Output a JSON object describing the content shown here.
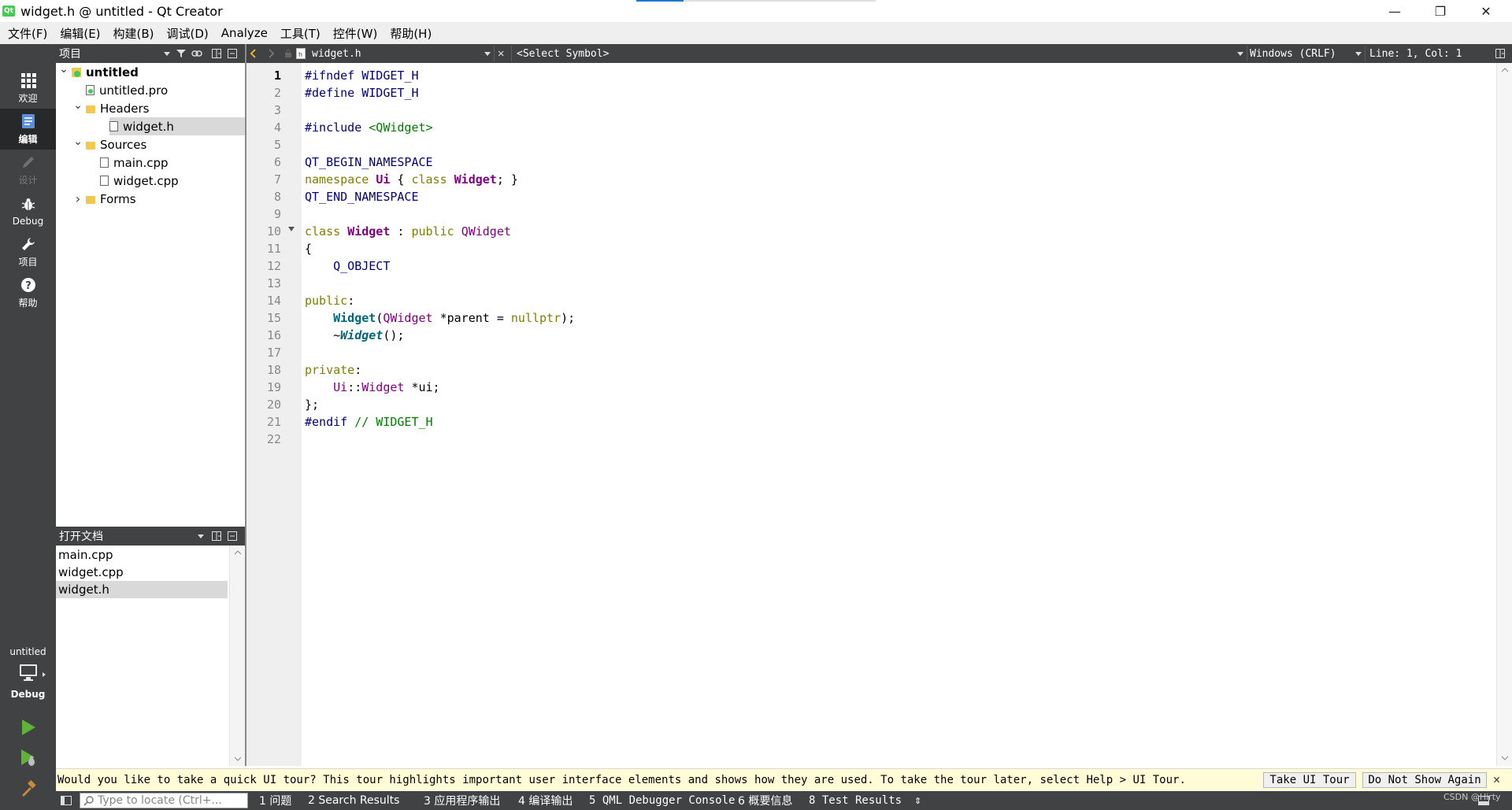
{
  "window": {
    "title": "widget.h @ untitled - Qt Creator",
    "app_icon_text": "Qt",
    "controls": {
      "minimize": "—",
      "maximize": "❐",
      "close": "✕"
    }
  },
  "menu": [
    "文件(F)",
    "编辑(E)",
    "构建(B)",
    "调试(D)",
    "Analyze",
    "工具(T)",
    "控件(W)",
    "帮助(H)"
  ],
  "modes": [
    {
      "id": "welcome",
      "label": "欢迎",
      "icon": "grid-icon",
      "state": "normal"
    },
    {
      "id": "edit",
      "label": "编辑",
      "icon": "edit-document-icon",
      "state": "active"
    },
    {
      "id": "design",
      "label": "设计",
      "icon": "pencil-icon",
      "state": "disabled"
    },
    {
      "id": "debug",
      "label": "Debug",
      "icon": "bug-icon",
      "state": "normal"
    },
    {
      "id": "projects",
      "label": "项目",
      "icon": "wrench-icon",
      "state": "normal"
    },
    {
      "id": "help",
      "label": "帮助",
      "icon": "help-icon",
      "state": "normal"
    }
  ],
  "kit": {
    "project": "untitled",
    "mode": "Debug"
  },
  "projects_pane": {
    "title": "项目",
    "tree": [
      {
        "label": "untitled",
        "depth": 0,
        "arrow": "down",
        "icon": "project-icon",
        "bold": true
      },
      {
        "label": "untitled.pro",
        "depth": 1,
        "arrow": "",
        "icon": "pro-file-icon"
      },
      {
        "label": "Headers",
        "depth": 1,
        "arrow": "down",
        "icon": "folder-icon"
      },
      {
        "label": "widget.h",
        "depth": 2,
        "arrow": "",
        "icon": "header-file-icon",
        "selected": true
      },
      {
        "label": "Sources",
        "depth": 1,
        "arrow": "down",
        "icon": "folder-icon"
      },
      {
        "label": "main.cpp",
        "depth": 2,
        "arrow": "",
        "icon": "source-file-icon"
      },
      {
        "label": "widget.cpp",
        "depth": 2,
        "arrow": "",
        "icon": "source-file-icon"
      },
      {
        "label": "Forms",
        "depth": 1,
        "arrow": "right",
        "icon": "folder-icon"
      }
    ]
  },
  "open_docs": {
    "title": "打开文档",
    "items": [
      {
        "label": "main.cpp",
        "selected": false
      },
      {
        "label": "widget.cpp",
        "selected": false
      },
      {
        "label": "widget.h",
        "selected": true
      }
    ]
  },
  "editor_toolbar": {
    "file": "widget.h",
    "symbol": "<Select Symbol>",
    "line_endings": "Windows (CRLF)",
    "position": "Line: 1, Col: 1"
  },
  "editor": {
    "current_line": 1,
    "lines": [
      [
        [
          "k-macro",
          "#ifndef WIDGET_H"
        ]
      ],
      [
        [
          "k-macro",
          "#define WIDGET_H"
        ]
      ],
      [],
      [
        [
          "k-macro",
          "#include "
        ],
        [
          "k-str",
          "<QWidget>"
        ]
      ],
      [],
      [
        [
          "k-macro",
          "QT_BEGIN_NAMESPACE"
        ]
      ],
      [
        [
          "k-key",
          "namespace "
        ],
        [
          "k-typeb",
          "Ui"
        ],
        [
          "",
          " { "
        ],
        [
          "k-key",
          "class "
        ],
        [
          "k-typeb",
          "Widget"
        ],
        [
          "",
          "; }"
        ]
      ],
      [
        [
          "k-macro",
          "QT_END_NAMESPACE"
        ]
      ],
      [],
      [
        [
          "k-key",
          "class "
        ],
        [
          "k-typeb",
          "Widget"
        ],
        [
          "",
          " : "
        ],
        [
          "k-key",
          "public "
        ],
        [
          "k-type",
          "QWidget"
        ]
      ],
      [
        [
          "",
          "{"
        ]
      ],
      [
        [
          "",
          "    "
        ],
        [
          "k-macro",
          "Q_OBJECT"
        ]
      ],
      [],
      [
        [
          "k-key",
          "public"
        ],
        [
          "",
          ":"
        ]
      ],
      [
        [
          "",
          "    "
        ],
        [
          "k-ctor",
          "Widget"
        ],
        [
          "",
          "("
        ],
        [
          "k-type",
          "QWidget"
        ],
        [
          "",
          " *parent = "
        ],
        [
          "k-key",
          "nullptr"
        ],
        [
          "",
          ");"
        ]
      ],
      [
        [
          "",
          "    ~"
        ],
        [
          "k-funci",
          "Widget"
        ],
        [
          "",
          "();"
        ]
      ],
      [],
      [
        [
          "k-key",
          "private"
        ],
        [
          "",
          ":"
        ]
      ],
      [
        [
          "",
          "    "
        ],
        [
          "k-type",
          "Ui"
        ],
        [
          "",
          "::"
        ],
        [
          "k-type",
          "Widget"
        ],
        [
          "",
          " *ui;"
        ]
      ],
      [
        [
          "",
          "};"
        ]
      ],
      [
        [
          "k-macro",
          "#endif "
        ],
        [
          "k-com",
          "// WIDGET_H"
        ]
      ],
      []
    ]
  },
  "infobar": {
    "message": "Would you like to take a quick UI tour? This tour highlights important user interface elements and shows how they are used. To take the tour later, select Help > UI Tour.",
    "take_tour": "Take UI Tour",
    "dont_show": "Do Not Show Again"
  },
  "statusbar": {
    "locator_placeholder": "Type to locate (Ctrl+...",
    "panes": [
      "1 问题",
      "2 Search Results",
      "3 应用程序输出",
      "4 编译输出",
      "5 QML Debugger Console",
      "6 概要信息",
      "8 Test Results"
    ]
  },
  "watermark": "CSDN @Hirty"
}
